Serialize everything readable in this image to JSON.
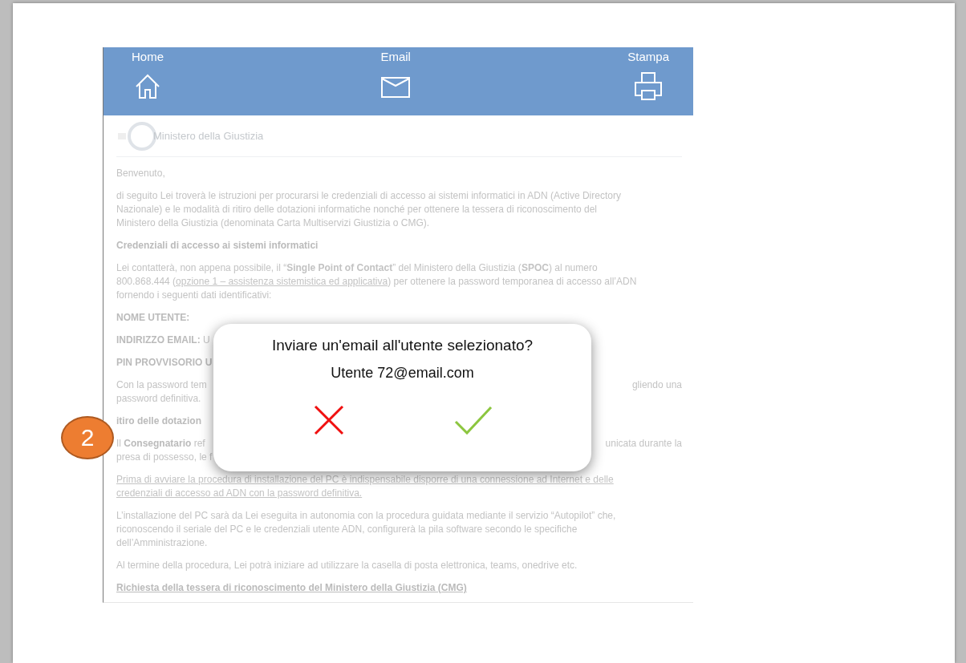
{
  "nav": [
    {
      "label": "Home"
    },
    {
      "label": "Email"
    },
    {
      "label": "Stampa"
    }
  ],
  "logo": {
    "text": "Ministero della Giustizia"
  },
  "document": {
    "blocks": [
      {
        "kind": "para",
        "lines": [
          "Benvenuto,"
        ]
      },
      {
        "kind": "para",
        "lines": [
          "di seguito Lei troverà le istruzioni per procurarsi le credenziali di accesso ai sistemi informatici in ADN (Active Directory",
          "Nazionale) e  le modalità di ritiro delle dotazioni informatiche nonché  per ottenere la tessera di riconoscimento del",
          "Ministero della Giustizia (denominata Carta Multiservizi Giustizia o CMG)."
        ]
      },
      {
        "kind": "heading",
        "lines": [
          "Credenziali di accesso ai sistemi informatici"
        ]
      },
      {
        "kind": "para",
        "lines": [
          "Lei contatterà, non appena possibile, il “**Single Point of Contact**” del Ministero della Giustizia (**SPOC**) al numero",
          {
            "before": "800.868.444 (",
            "link": "opzione 1 – assistenza sistemistica ed applicativa",
            "after": ") per ottenere la password temporanea di accesso all’ADN"
          },
          "fornendo i seguenti dati identificativi:"
        ]
      },
      {
        "kind": "heading",
        "lines": [
          "NOME UTENTE:"
        ]
      },
      {
        "kind": "split",
        "lines": [
          {
            "left": "**INDIRIZZO EMAIL:** U"
          }
        ]
      },
      {
        "kind": "split",
        "lines": [
          {
            "left": "**PIN PROVVISORIO U**"
          }
        ]
      },
      {
        "kind": "split",
        "lines": [
          {
            "left": "Con la password tem",
            "right": "gliendo una"
          },
          {
            "left": "password definitiva."
          }
        ]
      },
      {
        "kind": "split",
        "lines": [
          {
            "left": "**itiro delle dotazion**"
          }
        ]
      },
      {
        "kind": "split",
        "lines": [
          {
            "left": "Il **Consegnatario** ref",
            "right": "unicata durante la"
          },
          {
            "left": "presa di possesso, le f"
          }
        ]
      },
      {
        "kind": "underlined",
        "lines": [
          "Prima di avviare la procedura di installazione del PC è indispensabile disporre di una connessione ad Internet e delle",
          "credenziali di accesso ad ADN con la password definitiva."
        ]
      },
      {
        "kind": "para",
        "lines": [
          "L’installazione del PC sarà da Lei eseguita in autonomia con la procedura guidata mediante il servizio “Autopilot” che,",
          "riconoscendo il seriale del PC e le credenziali utente ADN, configurerà la pila software secondo le specifiche",
          "dell’Amministrazione."
        ]
      },
      {
        "kind": "para",
        "lines": [
          "Al termine della procedura, Lei potrà iniziare ad utilizzare la casella di posta elettronica, teams, onedrive etc."
        ]
      },
      {
        "kind": "heading_underlined",
        "lines": [
          "Richiesta della tessera di riconoscimento del Ministero della Giustizia (CMG)"
        ]
      }
    ]
  },
  "dialog": {
    "question": "Inviare un'email all'utente selezionato?",
    "recipient": "Utente 72@email.com",
    "buttons": [
      {
        "kind": "cancel"
      },
      {
        "kind": "confirm"
      }
    ]
  },
  "step_badge": "2"
}
